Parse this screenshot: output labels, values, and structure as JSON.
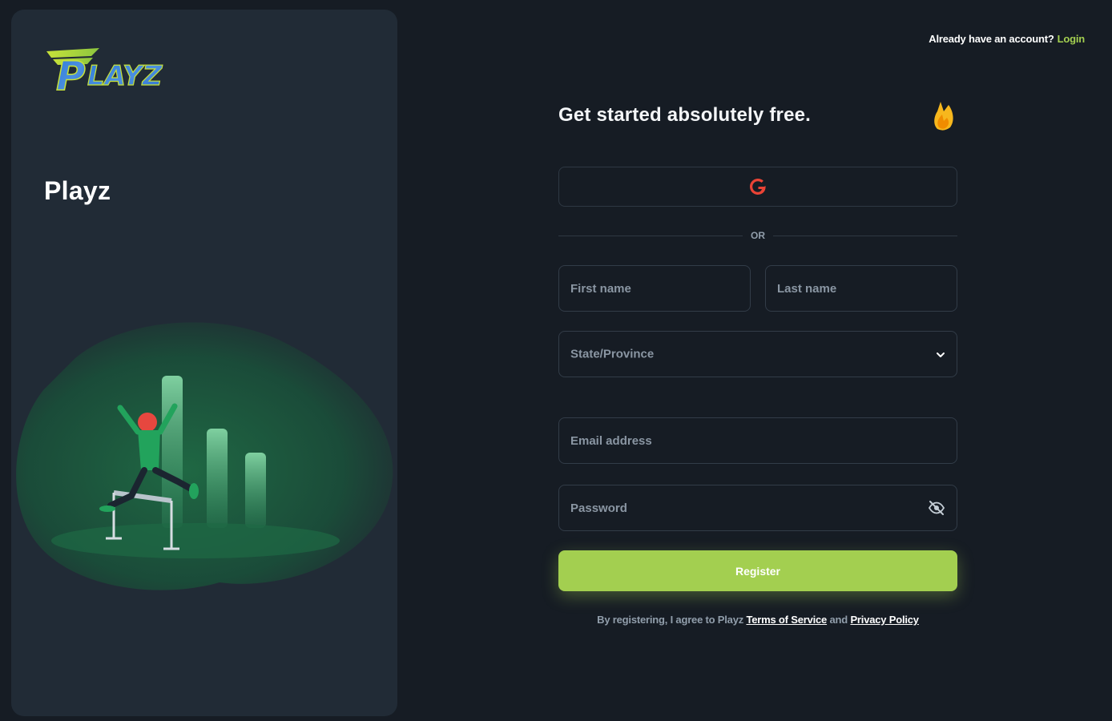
{
  "left_panel": {
    "logo_text": "PLAYZ",
    "brand_name": "Playz"
  },
  "header": {
    "login_prompt": "Already have an account?",
    "login_link": "Login"
  },
  "form": {
    "title": "Get started absolutely free.",
    "divider_text": "OR",
    "first_name_placeholder": "First name",
    "last_name_placeholder": "Last name",
    "state_placeholder": "State/Province",
    "email_placeholder": "Email address",
    "password_placeholder": "Password",
    "register_label": "Register",
    "terms_prefix": "By registering, I agree to Playz",
    "terms_link": "Terms of Service",
    "terms_and": "and",
    "privacy_link": "Privacy Policy"
  },
  "colors": {
    "background": "#161c24",
    "panel": "#212b36",
    "accent": "#a3cf50",
    "google_red": "#ea4335",
    "flame": "#f7b71d"
  },
  "icons": [
    "playz-logo",
    "flame-icon",
    "google-icon",
    "chevron-down-icon",
    "eye-off-icon"
  ]
}
